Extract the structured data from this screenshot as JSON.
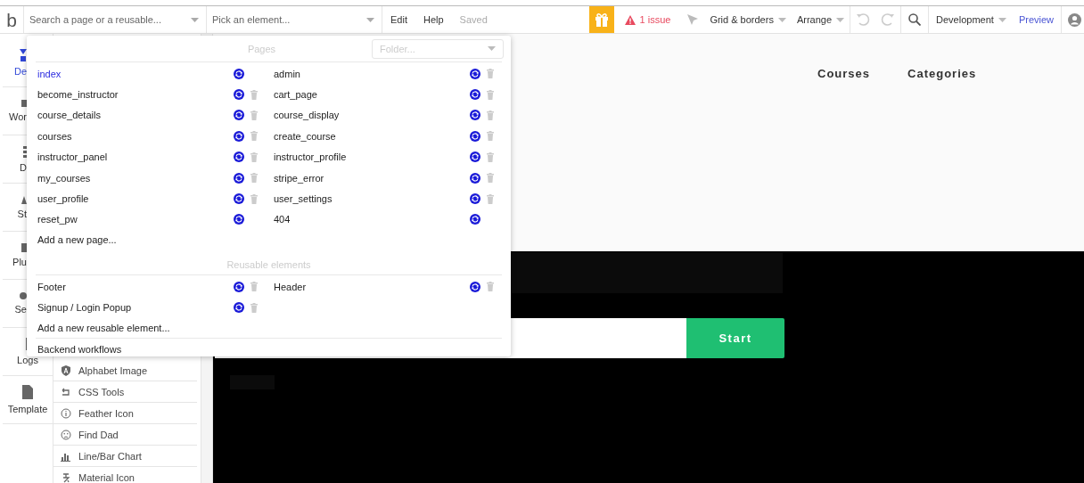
{
  "toolbar": {
    "logo": "b",
    "search": {
      "placeholder": "Search a page or a reusable..."
    },
    "element_picker": {
      "placeholder": "Pick an element..."
    },
    "menu": [
      "Edit",
      "Help"
    ],
    "save_status": "Saved",
    "issues": "1 issue",
    "grid_menu": "Grid & borders",
    "arrange_menu": "Arrange",
    "undo_disabled": true,
    "redo_disabled": true,
    "version_menu": "Development",
    "preview": "Preview"
  },
  "sidebar": {
    "tabs": [
      {
        "label": "De",
        "selected": true,
        "partial": true
      },
      {
        "label": "Wor",
        "selected": false,
        "partial": true
      },
      {
        "label": "D",
        "selected": false,
        "partial": true
      },
      {
        "label": "St",
        "selected": false,
        "partial": true
      },
      {
        "label": "Plu",
        "selected": false,
        "partial": true
      },
      {
        "label": "Se",
        "selected": false,
        "partial": true
      },
      {
        "label": "Logs",
        "selected": false,
        "partial": false
      },
      {
        "label": "Template",
        "selected": false,
        "partial": false
      }
    ]
  },
  "plugin_elements": [
    {
      "label": "Alphabet Image"
    },
    {
      "label": "CSS Tools"
    },
    {
      "label": "Feather Icon"
    },
    {
      "label": "Find Dad"
    },
    {
      "label": "Line/Bar Chart"
    },
    {
      "label": "Material Icon"
    }
  ],
  "page_menu": {
    "pages_heading": "Pages",
    "folder": {
      "placeholder": "Folder..."
    },
    "pages": [
      {
        "name": "index",
        "selected": true,
        "deletable": false
      },
      {
        "name": "admin",
        "selected": false,
        "deletable": true
      },
      {
        "name": "become_instructor",
        "selected": false,
        "deletable": true
      },
      {
        "name": "cart_page",
        "selected": false,
        "deletable": true
      },
      {
        "name": "course_details",
        "selected": false,
        "deletable": true
      },
      {
        "name": "course_display",
        "selected": false,
        "deletable": true
      },
      {
        "name": "courses",
        "selected": false,
        "deletable": true
      },
      {
        "name": "create_course",
        "selected": false,
        "deletable": true
      },
      {
        "name": "instructor_panel",
        "selected": false,
        "deletable": true
      },
      {
        "name": "instructor_profile",
        "selected": false,
        "deletable": true
      },
      {
        "name": "my_courses",
        "selected": false,
        "deletable": true
      },
      {
        "name": "stripe_error",
        "selected": false,
        "deletable": true
      },
      {
        "name": "user_profile",
        "selected": false,
        "deletable": true
      },
      {
        "name": "user_settings",
        "selected": false,
        "deletable": true
      },
      {
        "name": "reset_pw",
        "selected": false,
        "deletable": false
      },
      {
        "name": "404",
        "selected": false,
        "deletable": false
      }
    ],
    "add_page": "Add a new page...",
    "reusables_heading": "Reusable elements",
    "reusables": [
      {
        "name": "Footer",
        "selected": false,
        "deletable": true
      },
      {
        "name": "Header",
        "selected": false,
        "deletable": true
      },
      {
        "name": "Signup / Login Popup",
        "selected": false,
        "deletable": true
      }
    ],
    "add_reusable": "Add a new reusable element...",
    "backend": "Backend workflows"
  },
  "canvas": {
    "nav": [
      "Courses",
      "Categories"
    ],
    "start_button": "Start"
  }
}
